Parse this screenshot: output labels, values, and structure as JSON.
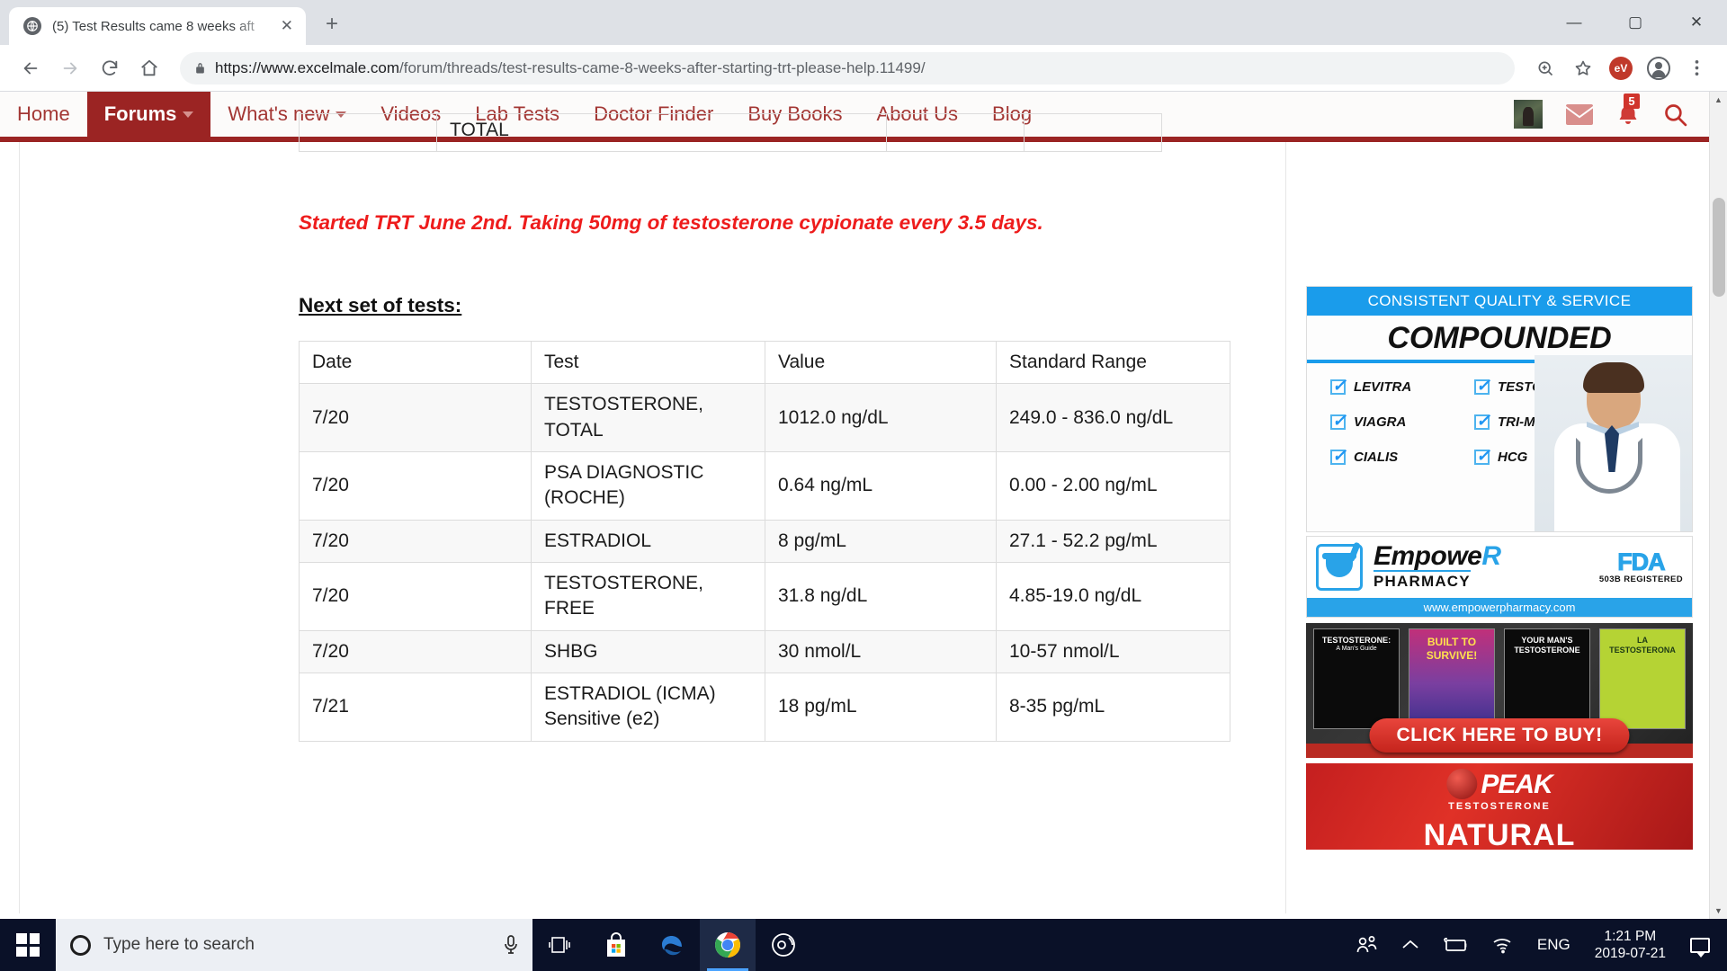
{
  "browser": {
    "tab": {
      "title": "(5) Test Results came 8 weeks aft",
      "favicon_icon": "globe-icon",
      "close_icon": "close-icon"
    },
    "new_tab_label": "+",
    "window_controls": {
      "minimize": "—",
      "maximize": "▢",
      "close": "✕"
    },
    "nav": {
      "back_icon": "arrow-left-icon",
      "forward_icon": "arrow-right-icon",
      "reload_icon": "reload-icon",
      "home_icon": "home-icon"
    },
    "omnibox": {
      "lock_icon": "lock-icon",
      "url_scheme": "https://www.excelmale.com",
      "url_path": "/forum/threads/test-results-came-8-weeks-after-starting-trt-please-help.11499/",
      "zoom_icon": "zoom-in-icon",
      "bookmark_icon": "star-icon",
      "extension_badge": "eV",
      "profile_icon": "profile-icon",
      "menu_icon": "kebab-menu-icon"
    }
  },
  "site": {
    "nav_items": [
      {
        "label": "Home",
        "has_caret": false,
        "active": false
      },
      {
        "label": "Forums",
        "has_caret": true,
        "active": true
      },
      {
        "label": "What's new",
        "has_caret": true,
        "active": false
      },
      {
        "label": "Videos",
        "has_caret": false,
        "active": false
      },
      {
        "label": "Lab Tests",
        "has_caret": false,
        "active": false
      },
      {
        "label": "Doctor Finder",
        "has_caret": false,
        "active": false
      },
      {
        "label": "Buy Books",
        "has_caret": false,
        "active": false
      },
      {
        "label": "About Us",
        "has_caret": false,
        "active": false
      },
      {
        "label": "Blog",
        "has_caret": false,
        "active": false
      }
    ],
    "nav_right": {
      "avatar_icon": "user-avatar",
      "mail_icon": "envelope-icon",
      "alerts_icon": "bell-icon",
      "alerts_count": "5",
      "search_icon": "search-icon"
    }
  },
  "post": {
    "clipped_row_text": "TOTAL",
    "red_note": "Started TRT June 2nd. Taking 50mg of testosterone cypionate every 3.5 days.",
    "section_heading": "Next set of tests:",
    "table": {
      "headers": [
        "Date",
        "Test",
        "Value",
        "Standard Range"
      ],
      "rows": [
        {
          "date": "7/20",
          "test": "TESTOSTERONE, TOTAL",
          "value": "1012.0 ng/dL",
          "range": "249.0 - 836.0 ng/dL"
        },
        {
          "date": "7/20",
          "test": "PSA DIAGNOSTIC (ROCHE)",
          "value": "0.64 ng/mL",
          "range": "0.00 - 2.00 ng/mL"
        },
        {
          "date": "7/20",
          "test": "ESTRADIOL",
          "value": "8 pg/mL",
          "range": "27.1 - 52.2 pg/mL"
        },
        {
          "date": "7/20",
          "test": "TESTOSTERONE, FREE",
          "value": "31.8 ng/dL",
          "range": "4.85-19.0 ng/dL"
        },
        {
          "date": "7/20",
          "test": "SHBG",
          "value": "30 nmol/L",
          "range": "10-57 nmol/L"
        },
        {
          "date": "7/21",
          "test": "ESTRADIOL (ICMA) Sensitive (e2)",
          "value": "18 pg/mL",
          "range": "8-35 pg/mL"
        }
      ]
    }
  },
  "sidebar": {
    "ad_compounded": {
      "banner": "CONSISTENT QUALITY & SERVICE",
      "title": "COMPOUNDED",
      "items": [
        "LEVITRA",
        "TESTOSTERONE",
        "VIAGRA",
        "TRI-MIX",
        "CIALIS",
        "HCG"
      ],
      "doctor_image": "doctor-photo"
    },
    "ad_empower": {
      "brand": "Empowe",
      "brand_rx": "R",
      "sub": "PHARMACY",
      "fda": "FDA",
      "fda_sub": "503B REGISTERED",
      "url": "www.empowerpharmacy.com",
      "logo_icon": "mortar-pestle-icon"
    },
    "ad_books": {
      "books": [
        {
          "title": "TESTOSTERONE:",
          "subtitle": "A Man's Guide"
        },
        {
          "title": "BUILT TO",
          "subtitle": "SURVIVE!"
        },
        {
          "title": "YOUR MAN'S",
          "subtitle": "TESTOSTERONE"
        },
        {
          "title": "LA TESTOSTERONA",
          "subtitle": ""
        }
      ],
      "cta": "CLICK HERE TO BUY!"
    },
    "ad_peak": {
      "brand": "PEAK",
      "sub": "TESTOSTERONE",
      "headline": "NATURAL"
    }
  },
  "taskbar": {
    "start_icon": "windows-logo-icon",
    "search_placeholder": "Type here to search",
    "cortana_icon": "cortana-circle-icon",
    "mic_icon": "microphone-icon",
    "items": [
      {
        "name": "task-view",
        "icon": "task-view-icon"
      },
      {
        "name": "microsoft-store",
        "icon": "store-icon"
      },
      {
        "name": "microsoft-edge",
        "icon": "edge-icon"
      },
      {
        "name": "google-chrome",
        "icon": "chrome-icon",
        "active": true
      },
      {
        "name": "media-player",
        "icon": "media-player-icon"
      }
    ],
    "tray": {
      "people_icon": "people-icon",
      "chevron_icon": "chevron-up-icon",
      "battery_icon": "battery-charging-icon",
      "wifi_icon": "wifi-icon",
      "language": "ENG",
      "time": "1:21 PM",
      "date": "2019-07-21",
      "action_center_icon": "notification-icon"
    }
  },
  "colors": {
    "brand_red": "#9b2423",
    "nav_text_red": "#a33734",
    "note_red": "#ee1c1c",
    "ad_blue": "#29a3e8",
    "taskbar": "#0a1128"
  }
}
